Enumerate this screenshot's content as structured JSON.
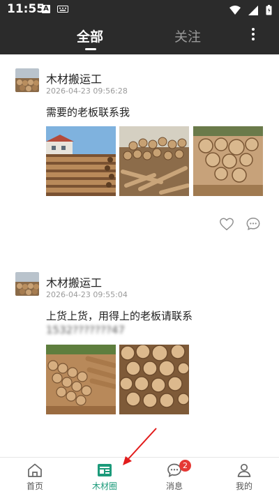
{
  "status_bar": {
    "time": "11:55",
    "notif_letter": "A"
  },
  "top_tabs": {
    "all": "全部",
    "follow": "关注"
  },
  "posts": [
    {
      "username": "木材搬运工",
      "time": "2026-04-23 09:56:28",
      "text_line1": "需要的老板联系我",
      "text_line2": ""
    },
    {
      "username": "木材搬运工",
      "time": "2026-04-23 09:55:04",
      "text_line1": "上货上货，用得上的老板请联系",
      "text_line2": "1532???????47"
    }
  ],
  "bottom_nav": {
    "items": [
      {
        "label": "首页",
        "icon": "home-icon"
      },
      {
        "label": "木材圈",
        "icon": "timber-circle-icon"
      },
      {
        "label": "消息",
        "icon": "message-icon",
        "badge": "2"
      },
      {
        "label": "我的",
        "icon": "profile-icon"
      }
    ],
    "active_index": 1
  },
  "colors": {
    "accent": "#1b9a7a",
    "header": "#2b2b2b",
    "badge": "#e53935"
  }
}
